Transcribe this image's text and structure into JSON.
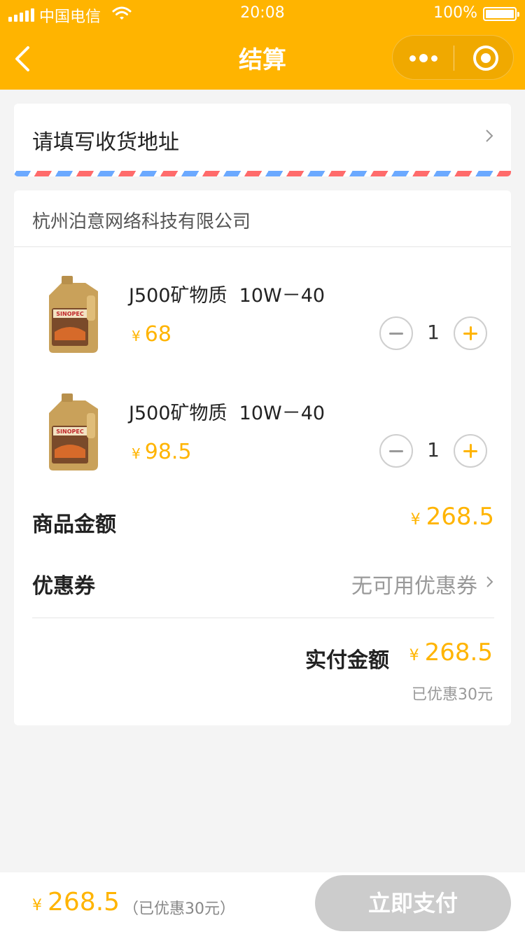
{
  "status_bar": {
    "carrier": "中国电信",
    "time": "20:08",
    "battery": "100%"
  },
  "nav": {
    "title": "结算"
  },
  "address": {
    "placeholder": "请填写收货地址"
  },
  "shop": {
    "name": "杭州泊意网络科技有限公司"
  },
  "items": [
    {
      "name": "J500矿物质  10W－40",
      "currency": "¥",
      "price": "68",
      "qty": "1"
    },
    {
      "name": "J500矿物质  10W－40",
      "currency": "¥",
      "price": "98.5",
      "qty": "1"
    }
  ],
  "summary": {
    "goods_label": "商品金额",
    "goods_currency": "¥",
    "goods_amount": "268.5",
    "coupon_label": "优惠券",
    "coupon_value": "无可用优惠券",
    "paid_label": "实付金额",
    "paid_currency": "¥",
    "paid_amount": "268.5",
    "saved": "已优惠30元"
  },
  "bottom": {
    "currency": "¥",
    "total": "268.5",
    "saved": "（已优惠30元）",
    "pay_label": "立即支付"
  },
  "colors": {
    "brand": "#ffb400",
    "pay_disabled": "#cccccc"
  }
}
